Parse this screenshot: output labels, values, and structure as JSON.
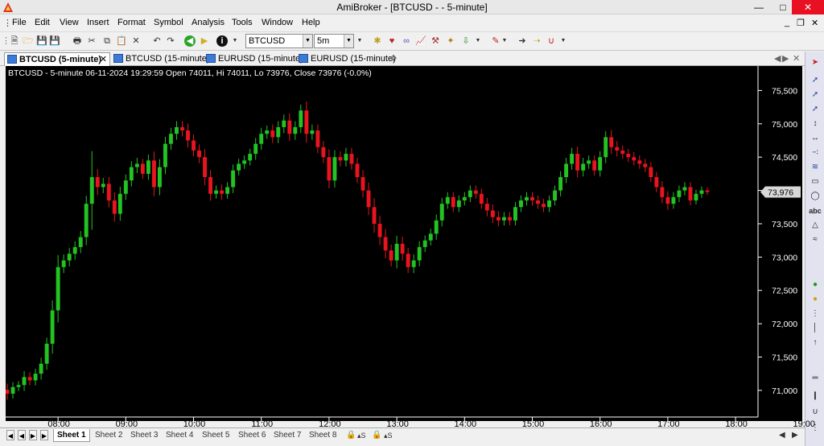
{
  "window": {
    "title": "AmiBroker - [BTCUSD -  - 5-minute]"
  },
  "menu": [
    "File",
    "Edit",
    "View",
    "Insert",
    "Format",
    "Symbol",
    "Analysis",
    "Tools",
    "Window",
    "Help"
  ],
  "toolbar": {
    "symbol": "BTCUSD",
    "interval": "5m"
  },
  "tabs": [
    {
      "label": "BTCUSD (5-minute)",
      "active": true
    },
    {
      "label": "BTCUSD (15-minute)",
      "active": false
    },
    {
      "label": "EURUSD (15-minute)",
      "active": false
    },
    {
      "label": "EURUSD (15-minute)",
      "active": false
    }
  ],
  "chart_header": "BTCUSD - 5-minute 06-11-2024 19:29:59 Open 74011, Hi 74011, Lo 73976, Close 73976 (-0.0%)",
  "sheets": [
    "Sheet 1",
    "Sheet 2",
    "Sheet 3",
    "Sheet 4",
    "Sheet 5",
    "Sheet 6",
    "Sheet 7",
    "Sheet 8"
  ],
  "right_toolbar_label": "abc",
  "colors": {
    "up": "#22c322",
    "down": "#e8141e",
    "background": "#000000",
    "last_price_box": "#d8d8d8"
  },
  "chart_data": {
    "type": "candlestick",
    "title": "",
    "y_ticks": [
      "75,500",
      "75,000",
      "74,500",
      "74,000",
      "73,500",
      "73,000",
      "72,500",
      "72,000",
      "71,500",
      "71,000"
    ],
    "y_tick_values": [
      75500,
      75000,
      74500,
      74000,
      73500,
      73000,
      72500,
      72000,
      71500,
      71000
    ],
    "x_ticks": [
      "08:00",
      "09:00",
      "10:00",
      "11:00",
      "12:00",
      "13:00",
      "14:00",
      "15:00",
      "16:00",
      "17:00",
      "18:00",
      "19:00"
    ],
    "last_price_label": "73,976",
    "last_price": 73976,
    "ylim": [
      70600,
      75650
    ],
    "close": [
      70950,
      71050,
      71080,
      71200,
      71150,
      71250,
      71400,
      71700,
      72200,
      72850,
      72950,
      73050,
      73150,
      73300,
      73800,
      74200,
      74050,
      74100,
      73850,
      73650,
      73950,
      74150,
      74350,
      74400,
      74250,
      74450,
      74050,
      74350,
      74700,
      74850,
      74950,
      74900,
      74750,
      74600,
      74500,
      74200,
      73950,
      74000,
      73950,
      74050,
      74300,
      74400,
      74450,
      74550,
      74700,
      74850,
      74900,
      74800,
      74950,
      75050,
      74850,
      74950,
      75200,
      74850,
      74900,
      74650,
      74500,
      74150,
      74500,
      74450,
      74550,
      74400,
      74200,
      74000,
      73750,
      73500,
      73300,
      73100,
      72950,
      73200,
      73050,
      72850,
      72950,
      73150,
      73250,
      73350,
      73550,
      73800,
      73900,
      73750,
      73850,
      73900,
      74000,
      73950,
      73800,
      73700,
      73600,
      73550,
      73600,
      73550,
      73750,
      73850,
      73900,
      73850,
      73800,
      73750,
      73850,
      74000,
      74200,
      74400,
      74550,
      74300,
      74400,
      74450,
      74300,
      74500,
      74800,
      74650,
      74600,
      74550,
      74500,
      74450,
      74400,
      74350,
      74200,
      74050,
      73900,
      73800,
      73900,
      74000,
      74050,
      73850,
      73950,
      74000,
      73976
    ],
    "range": [
      300,
      250,
      200,
      300,
      250,
      250,
      300,
      300,
      500,
      600,
      300,
      300,
      300,
      300,
      400,
      1300,
      400,
      300,
      350,
      400,
      350,
      300,
      300,
      300,
      250,
      300,
      450,
      400,
      350,
      300,
      300,
      300,
      350,
      300,
      300,
      400,
      350,
      250,
      300,
      250,
      300,
      250,
      250,
      250,
      300,
      300,
      250,
      300,
      300,
      300,
      350,
      300,
      300,
      450,
      300,
      300,
      300,
      400,
      350,
      300,
      300,
      300,
      300,
      350,
      400,
      450,
      400,
      400,
      300,
      400,
      350,
      300,
      300,
      300,
      250,
      250,
      300,
      300,
      250,
      250,
      250,
      250,
      250,
      250,
      250,
      300,
      300,
      300,
      250,
      250,
      250,
      250,
      250,
      250,
      250,
      250,
      250,
      250,
      300,
      300,
      300,
      350,
      300,
      250,
      250,
      300,
      300,
      350,
      300,
      250,
      250,
      250,
      250,
      250,
      250,
      250,
      300,
      300,
      250,
      250,
      250,
      250,
      200,
      200,
      150
    ]
  }
}
